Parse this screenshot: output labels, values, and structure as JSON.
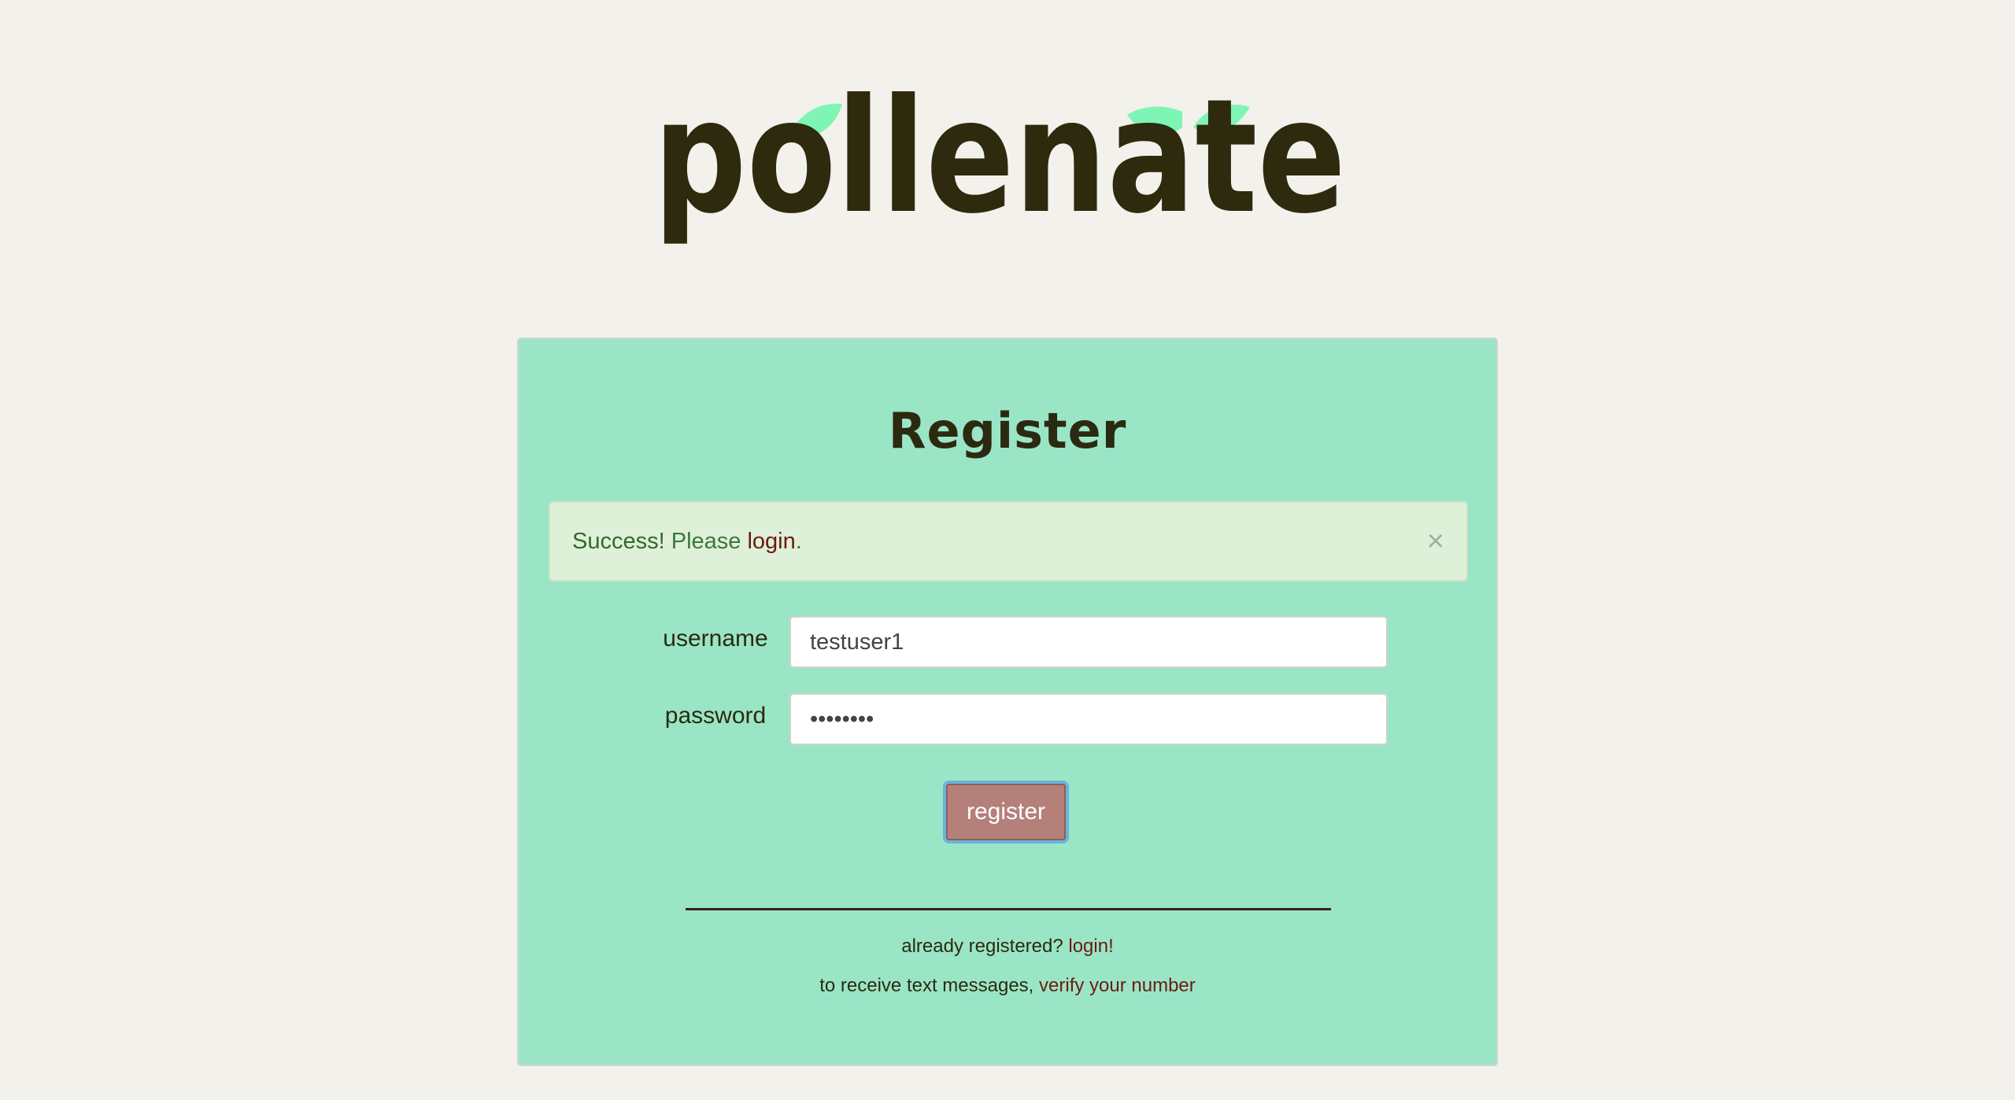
{
  "logo": {
    "text": "pollenate",
    "leaf_color": "#7ef5b4",
    "text_color": "#2d2a0e"
  },
  "card": {
    "title": "Register"
  },
  "alert": {
    "strong": "Success!",
    "text": "Please",
    "link": "login",
    "end": ".",
    "close": "×"
  },
  "form": {
    "username_label": "username",
    "username_value": "testuser1",
    "password_label": "password",
    "password_value": "••••••••",
    "submit_label": "register"
  },
  "footer": {
    "registered_text": "already registered?",
    "registered_link": "login!",
    "sms_text": "to receive text messages,",
    "sms_link": "verify your number"
  },
  "colors": {
    "page_bg": "#f2f1ec",
    "card_bg": "#9ae5c6",
    "alert_bg": "#dff0d8",
    "button_bg": "#b5807a",
    "link": "#6b1c10"
  }
}
